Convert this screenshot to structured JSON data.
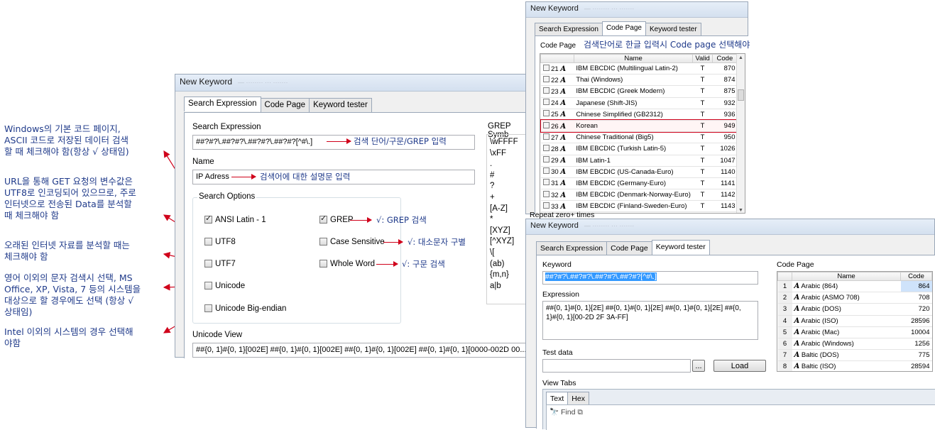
{
  "annotations": {
    "windows_cp": [
      "Windows의 기본 코드 페이지,",
      "ASCII 코드로 저장된 데이터 검색",
      "할 때 체크해야 함(항상 √ 상태임)"
    ],
    "utf8": [
      "URL을 통해 GET 요청의 변수값은",
      "UTF8로 인코딩되어 있으므로, 주로",
      "인터넷으로 전송된 Data를 분석할",
      "때 체크해야 함"
    ],
    "utf7": [
      "오래된 인터넷 자료를 분석할 때는",
      "체크해야 함"
    ],
    "unicode": [
      "영어 이외의 문자 검색시 선택, MS",
      "Office, XP, Vista, 7 등의 시스템을",
      "대상으로 할 경우에도 선택 (항상 √",
      "상태임)"
    ],
    "bigendian": [
      "Intel 이외의 시스템의 경우 선택해",
      "야함"
    ],
    "search_expr_note": "검색 단어/구문/GREP 입력",
    "name_note": "검색어에 대한 설명문 입력",
    "grep_note": "√: GREP 검색",
    "case_note": "√: 대소문자 구별",
    "whole_note": "√: 구문 검색",
    "codepage_note": "검색단어로 한글 입력시 Code page 선택해야"
  },
  "win1": {
    "title": "New Keyword",
    "tabs": [
      "Search Expression",
      "Code Page",
      "Keyword tester"
    ],
    "search_expression_label": "Search Expression",
    "search_expression_value": "##?#?\\.##?#?\\.##?#?\\.##?#?[^#\\.]",
    "name_label": "Name",
    "name_value": "IP Adress",
    "search_options_label": "Search Options",
    "options": {
      "ansi": "ANSI Latin - 1",
      "utf8": "UTF8",
      "utf7": "UTF7",
      "unicode": "Unicode",
      "bigendian": "Unicode Big-endian",
      "grep": "GREP",
      "case": "Case Sensitive",
      "whole": "Whole Word"
    },
    "grep_symbols_label": "GREP Symb",
    "grep_symbols": [
      "\\wFFFF",
      "\\xFF",
      ".",
      "#",
      "?",
      "+",
      "[A-Z]",
      "*",
      "[XYZ]",
      "[^XYZ]",
      "\\[",
      "(ab)",
      "{m,n}",
      "a|b"
    ],
    "unicode_view_label": "Unicode View",
    "unicode_view_value": "##{0, 1}#{0, 1}[002E] ##{0, 1}#{0, 1}[002E] ##{0, 1}#{0, 1}[002E] ##{0, 1}#{0, 1}[0000-002D 00..."
  },
  "win2": {
    "title": "New Keyword",
    "tabs": [
      "Search Expression",
      "Code Page",
      "Keyword tester"
    ],
    "code_page_label": "Code Page",
    "columns": [
      "Name",
      "Valid",
      "Code"
    ],
    "rows": [
      {
        "num": "21",
        "name": "IBM EBCDIC (Multilingual Latin-2)",
        "valid": "T",
        "code": "870"
      },
      {
        "num": "22",
        "name": "Thai (Windows)",
        "valid": "T",
        "code": "874"
      },
      {
        "num": "23",
        "name": "IBM EBCDIC (Greek Modern)",
        "valid": "T",
        "code": "875"
      },
      {
        "num": "24",
        "name": "Japanese (Shift-JIS)",
        "valid": "T",
        "code": "932"
      },
      {
        "num": "25",
        "name": "Chinese Simplified (GB2312)",
        "valid": "T",
        "code": "936"
      },
      {
        "num": "26",
        "name": "Korean",
        "valid": "T",
        "code": "949"
      },
      {
        "num": "27",
        "name": "Chinese Traditional (Big5)",
        "valid": "T",
        "code": "950"
      },
      {
        "num": "28",
        "name": "IBM EBCDIC (Turkish Latin-5)",
        "valid": "T",
        "code": "1026"
      },
      {
        "num": "29",
        "name": "IBM Latin-1",
        "valid": "T",
        "code": "1047"
      },
      {
        "num": "30",
        "name": "IBM EBCDIC (US-Canada-Euro)",
        "valid": "T",
        "code": "1140"
      },
      {
        "num": "31",
        "name": "IBM EBCDIC (Germany-Euro)",
        "valid": "T",
        "code": "1141"
      },
      {
        "num": "32",
        "name": "IBM EBCDIC (Denmark-Norway-Euro)",
        "valid": "T",
        "code": "1142"
      },
      {
        "num": "33",
        "name": "IBM EBCDIC (Finland-Sweden-Euro)",
        "valid": "T",
        "code": "1143"
      }
    ],
    "below_text": "Repeat zero+ times"
  },
  "win3": {
    "title": "New Keyword",
    "tabs": [
      "Search Expression",
      "Code Page",
      "Keyword tester"
    ],
    "keyword_label": "Keyword",
    "keyword_value": "##?#?\\.##?#?\\.##?#?\\.##?#?[^#\\.]",
    "expression_label": "Expression",
    "expression_value": "##{0, 1}#{0, 1}[2E] ##{0, 1}#{0, 1}[2E] ##{0, 1}#{0, 1}[2E] ##{0, 1}#{0, 1}[00-2D 2F 3A-FF]",
    "test_data_label": "Test data",
    "browse_label": "...",
    "load_label": "Load",
    "view_tabs_label": "View Tabs",
    "view_tabs": [
      "Text",
      "Hex"
    ],
    "find_label": "Find",
    "code_page_label": "Code Page",
    "columns": [
      "Name",
      "Code"
    ],
    "rows": [
      {
        "num": "1",
        "name": "Arabic (864)",
        "code": "864"
      },
      {
        "num": "2",
        "name": "Arabic (ASMO 708)",
        "code": "708"
      },
      {
        "num": "3",
        "name": "Arabic (DOS)",
        "code": "720"
      },
      {
        "num": "4",
        "name": "Arabic (ISO)",
        "code": "28596"
      },
      {
        "num": "5",
        "name": "Arabic (Mac)",
        "code": "10004"
      },
      {
        "num": "6",
        "name": "Arabic (Windows)",
        "code": "1256"
      },
      {
        "num": "7",
        "name": "Baltic (DOS)",
        "code": "775"
      },
      {
        "num": "8",
        "name": "Baltic (ISO)",
        "code": "28594"
      }
    ]
  },
  "colors": {
    "arrow": "#d0021b",
    "annotation": "#1f3a8a",
    "highlight": "#cfe3fb"
  }
}
